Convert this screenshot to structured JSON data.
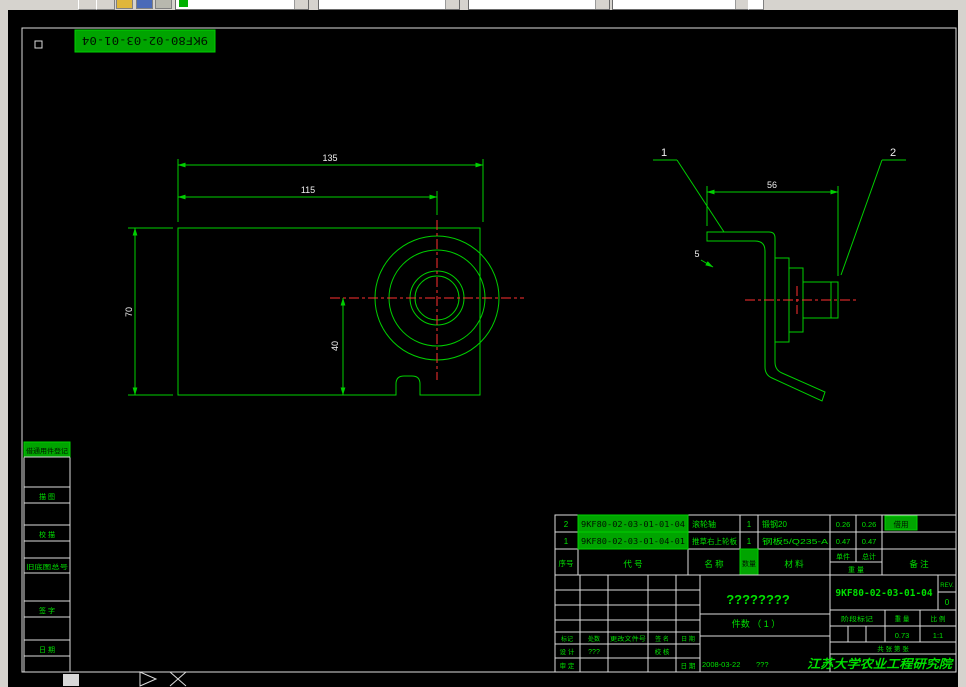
{
  "sheet": {
    "code_box": "9KF80-02-03-01-04"
  },
  "margin_blocks": [
    "借通用件登记",
    "描  图",
    "校  描",
    "旧底图总号",
    "签  字",
    "日  期"
  ],
  "dims": {
    "w135": "135",
    "w115": "115",
    "h70": "70",
    "h40": "40",
    "w56": "56",
    "t5": "5"
  },
  "balloons": {
    "n1": "1",
    "n2": "2"
  },
  "bom": {
    "header": {
      "seq": "序号",
      "code": "代  号",
      "name": "名  称",
      "qty": "数量",
      "material": "材    料",
      "unit": "单件",
      "total": "总计",
      "weight": "重  量",
      "remark": "备  注"
    },
    "rows": [
      {
        "seq": "2",
        "code": "9KF80-02-03-01-01-04",
        "name": "滚轮轴",
        "qty": "1",
        "material": "锻钢20",
        "unit": "0.26",
        "total": "0.26",
        "remark": "借用"
      },
      {
        "seq": "1",
        "code": "9KF80-02-03-01-04-01",
        "name": "推草右上轮板",
        "qty": "1",
        "material": "钢板5/Q235-A",
        "unit": "0.47",
        "total": "0.47",
        "remark": ""
      }
    ]
  },
  "tb": {
    "rev_cols": {
      "mark": "标记",
      "count": "处数",
      "doc": "更改文件号",
      "sign": "签 名",
      "date": "日 期"
    },
    "design": "设 计",
    "design_sign": "???",
    "check": "校 核",
    "approve": "审 定",
    "date_label": "日 期",
    "date": "2008-03-22",
    "extra": "???",
    "title": "????????",
    "pieces": "件数 （ 1 ）",
    "dwg_no": "9KF80-02-03-01-04",
    "rev_label": "REV.",
    "rev": "0",
    "stage": "阶段标记",
    "weight_label": "重 量",
    "scale_label": "比 例",
    "weight": "0.73",
    "scale": "1:1",
    "sheets": "共  张 第  张",
    "company": "江苏大学农业工程研究院"
  }
}
